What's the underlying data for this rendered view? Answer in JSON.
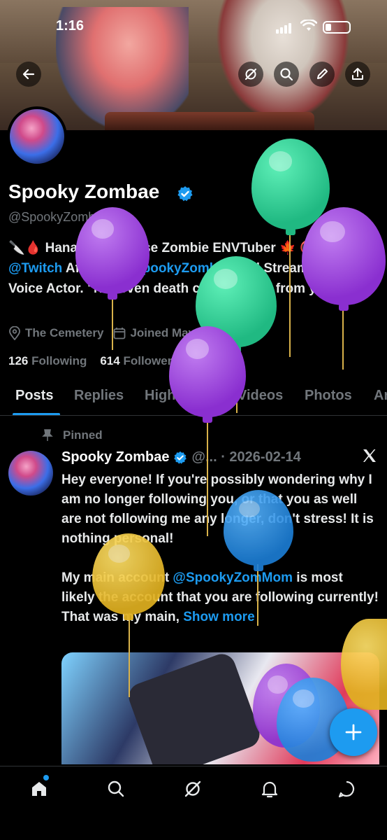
{
  "status_bar": {
    "time": "1:16"
  },
  "profile": {
    "name": "Spooky Zombae",
    "handle": "@SpookyZombae",
    "bio_line1_text": "Hanahaki Disease Zombie ENVTuber",
    "bio_line2_link1": "@Twitch",
    "bio_line2_text1": " Affilate! | ",
    "bio_line2_link2": "#SpookyZombae",
    "bio_line2_text2": " | Streamer, Artist, Voice Actor. \"Not even death can keep me from you...\"",
    "location": "The Cemetery",
    "joined": "Joined May 2022",
    "following_count": "126",
    "following_label": "Following",
    "followers_count": "614",
    "followers_label": "Followers"
  },
  "tabs": [
    "Posts",
    "Replies",
    "Highlights",
    "Videos",
    "Photos",
    "Ar"
  ],
  "post": {
    "pinned_label": "Pinned",
    "author": "Spooky Zombae",
    "meta": "@... · 2026-02-14",
    "para1": "Hey everyone! If you're possibly wondering why I am no longer following you, or that you as well are not following me any longer, don't stress! It is nothing personal!",
    "para2_pre": "My main account ",
    "para2_link": "@SpookyZomMom",
    "para2_post": " is most likely the account that you are following currently! That was my main, ",
    "show_more": "Show more"
  },
  "icons": {
    "back": "back-arrow-icon",
    "grok": "grok-icon",
    "search": "search-icon",
    "edit": "edit-icon",
    "share": "share-icon",
    "location": "location-pin-icon",
    "calendar": "calendar-icon",
    "compose": "plus-icon",
    "nav": [
      "home-icon",
      "search-icon",
      "grok-icon",
      "bell-icon",
      "messages-icon"
    ]
  },
  "colors": {
    "accent": "#1d9bf0",
    "muted": "#71767b",
    "text": "#e7e9ea"
  }
}
